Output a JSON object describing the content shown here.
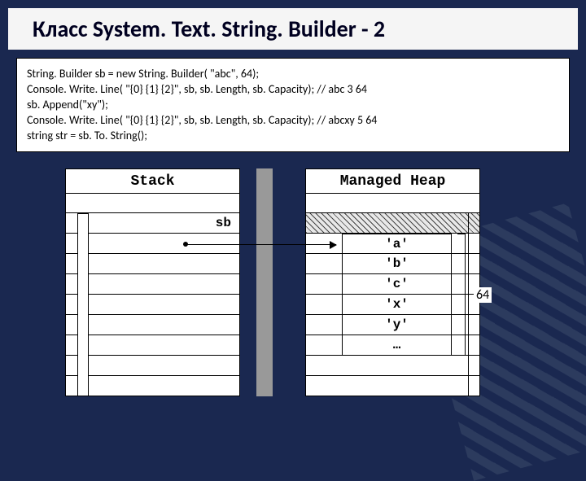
{
  "title": "Класс System. Text. String. Builder - 2",
  "code": {
    "l1": "String. Builder sb = new String. Builder( \"abc\", 64);",
    "l2": "Console. Write. Line( \"{0} {1} {2}\",   sb, sb. Length, sb. Capacity); // abc 3 64",
    "l3": "sb. Append(\"xy\");",
    "l4": "Console. Write. Line( \"{0} {1} {2}\",   sb, sb. Length, sb. Capacity); // abcxy 5 64",
    "l5": "string str = sb. To. String();"
  },
  "diagram": {
    "stack_header": "Stack",
    "heap_header": "Managed Heap",
    "sb_label": "sb",
    "capacity_label": "64",
    "heap_cells": [
      "'a'",
      "'b'",
      "'c'",
      "'x'",
      "'y'",
      "…"
    ]
  }
}
